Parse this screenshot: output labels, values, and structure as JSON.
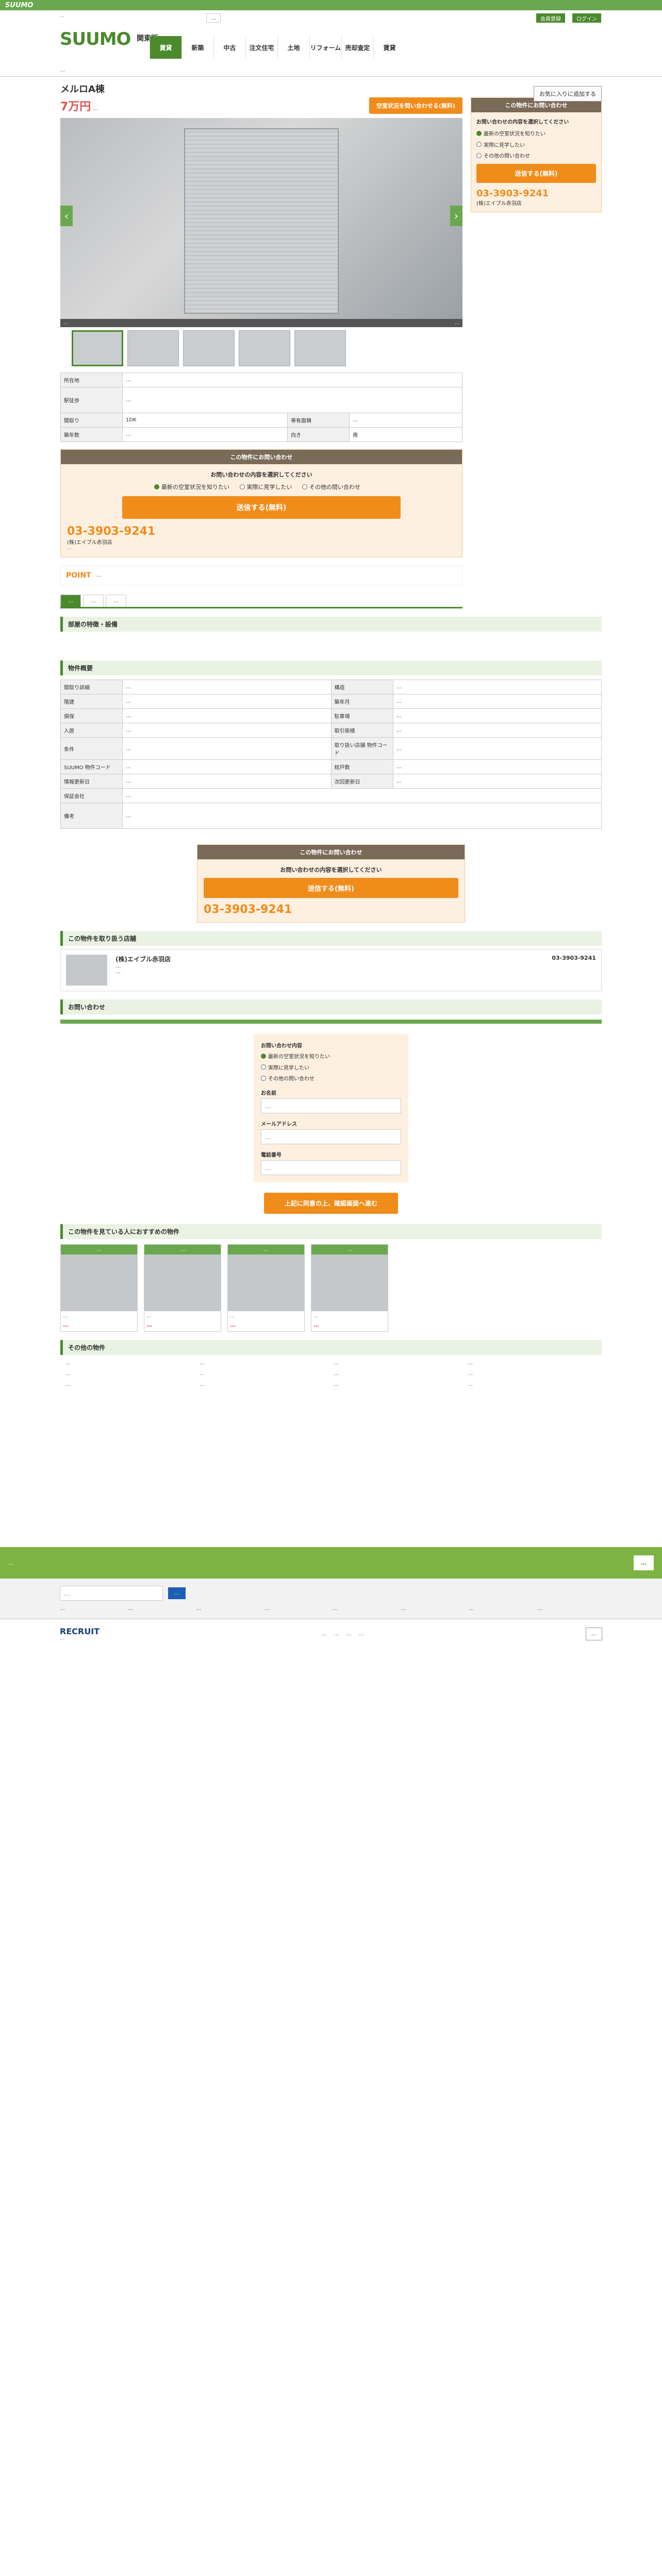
{
  "site": {
    "logo": "SUUMO",
    "brand": "SUUMO",
    "region": "関東版",
    "top_note": "…",
    "nav_search": "…",
    "nav_buttons": [
      "会員登録",
      "ログイン"
    ]
  },
  "nav": {
    "items": [
      "賃貸",
      "新築",
      "中古",
      "注文住宅",
      "土地",
      "リフォーム",
      "売却査定",
      "賃貸"
    ]
  },
  "breadcrumb": "…",
  "listing": {
    "title": "メルロA棟",
    "price": "7万円",
    "price_sub": "…",
    "fav_label": "お気に入りに追加する",
    "cta_top": "空室状況を問い合わせる(無料)"
  },
  "photo": {
    "caption": "…",
    "count": "…"
  },
  "spec": {
    "rows": [
      {
        "k": "所在地",
        "v": "…"
      },
      {
        "k": "駅徒歩",
        "v": "…"
      },
      {
        "k": "間取り",
        "v": "1DK"
      },
      {
        "k": "専有面積",
        "v": "…"
      },
      {
        "k": "築年数",
        "v": "…"
      },
      {
        "k": "向き",
        "v": "南"
      }
    ]
  },
  "inquiry": {
    "header": "この物件にお問い合わせ",
    "prompt": "お問い合わせの内容を選択してください",
    "opt1": "最新の空室状況を知りたい",
    "opt2": "実際に見学したい",
    "opt3": "その他の問い合わせ",
    "submit": "送信する(無料)",
    "tel": "03-3903-9241",
    "agent": "(株)エイブル赤羽店",
    "hours": "…"
  },
  "point": {
    "label": "POINT",
    "text": "…"
  },
  "tabs": [
    "…",
    "…",
    "…"
  ],
  "sections": {
    "features": "部屋の特徴・設備",
    "overview": "物件概要",
    "agency": "この物件を取り扱う店舗",
    "contact": "お問い合わせ",
    "recommend": "この物件を見ている人におすすめの物件",
    "others": "その他の物件"
  },
  "detail_rows": [
    {
      "k": "間取り詳細",
      "v": "…",
      "k2": "構造",
      "v2": "…"
    },
    {
      "k": "階建",
      "v": "…",
      "k2": "築年月",
      "v2": "…"
    },
    {
      "k": "損保",
      "v": "…",
      "k2": "駐車場",
      "v2": "…"
    },
    {
      "k": "入居",
      "v": "…",
      "k2": "取引態様",
      "v2": "…"
    },
    {
      "k": "条件",
      "v": "…",
      "k2": "取り扱い店舗 物件コード",
      "v2": "…"
    },
    {
      "k": "SUUMO 物件コード",
      "v": "…",
      "k2": "総戸数",
      "v2": "…"
    },
    {
      "k": "情報更新日",
      "v": "…",
      "k2": "次回更新日",
      "v2": "…"
    },
    {
      "k": "保証会社",
      "v": "…",
      "k2": "",
      "v2": ""
    },
    {
      "k": "備考",
      "v": "…",
      "k2": "",
      "v2": ""
    }
  ],
  "agency": {
    "name": "(株)エイブル赤羽店",
    "address": "…",
    "tel": "03-3903-9241",
    "hours": "…"
  },
  "form": {
    "label_content": "お問い合わせ内容",
    "label_name": "お名前",
    "label_email": "メールアドレス",
    "label_tel": "電話番号",
    "name_ph": "…",
    "email_ph": "…",
    "tel_ph": "…",
    "submit": "上記に同意の上、確認画面へ進む",
    "required": "必須"
  },
  "recommend": [
    {
      "tag": "…",
      "text": "…",
      "price": "…"
    },
    {
      "tag": "…",
      "text": "…",
      "price": "…"
    },
    {
      "tag": "…",
      "text": "…",
      "price": "…"
    },
    {
      "tag": "…",
      "text": "…",
      "price": "…"
    }
  ],
  "others_links": [
    "…",
    "…",
    "…",
    "…",
    "…",
    "…",
    "…",
    "…",
    "…",
    "…",
    "…",
    "…"
  ],
  "banner": {
    "text": "…",
    "button": "…"
  },
  "footer": {
    "links": [
      "…",
      "…",
      "…",
      "…",
      "…",
      "…",
      "…",
      "…"
    ],
    "search_ph": "…",
    "search_btn": "…"
  },
  "recruit": {
    "name": "RECRUIT",
    "copy": "…",
    "links": [
      "…",
      "…",
      "…",
      "…"
    ],
    "right_btn": "…"
  }
}
